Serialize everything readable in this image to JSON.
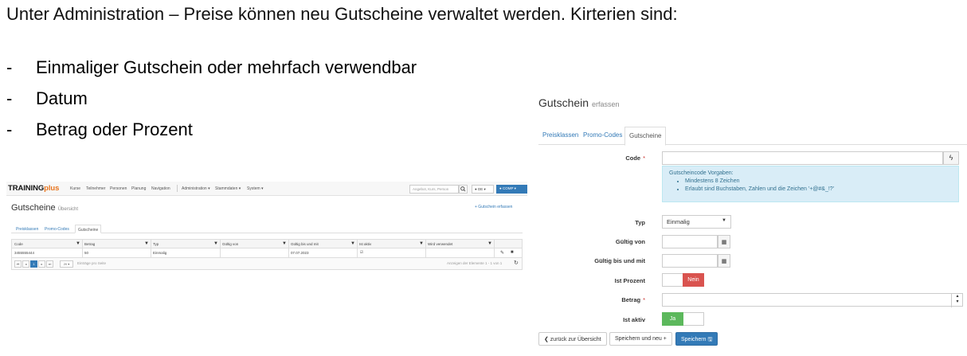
{
  "slide": {
    "intro": "Unter Administration – Preise können neu Gutscheine verwaltet werden. Kirterien sind:",
    "bullets": [
      "Einmaliger Gutschein oder mehrfach verwendbar",
      "Datum",
      "Betrag oder Prozent"
    ]
  },
  "overview": {
    "brand_a": "TRAINING",
    "brand_b": "plus",
    "nav": [
      "Kurse",
      "Teilnehmer",
      "Personen",
      "Planung",
      "Navigation",
      "Administration ▾",
      "Stammdaten ▾",
      "System ▾"
    ],
    "search_placeholder": "Angebot, Kurs, Person",
    "lang": "DE ▾",
    "user": "COMP ▾",
    "title": "Gutscheine",
    "subtitle": "Übersicht",
    "add_link": "+ Gutschein erfassen",
    "tabs": [
      "Preisklassen",
      "Promo-Codes",
      "Gutscheine"
    ],
    "columns": [
      "Code",
      "Betrag",
      "Typ",
      "Gültig von",
      "Gültig bis und mit",
      "Ist aktiv",
      "Wird verwendet"
    ],
    "row": [
      "3455555444",
      "50",
      "Einmalig",
      "",
      "07.07.2023",
      "",
      ""
    ],
    "pager_current": "1",
    "page_size": "20 ▾",
    "page_size_label": "Einträge pro Seite",
    "summary": "Anzeigen der Elemente 1 - 1 von 1"
  },
  "form": {
    "title": "Gutschein",
    "subtitle": "erfassen",
    "tabs": [
      "Preisklassen",
      "Promo-Codes",
      "Gutscheine"
    ],
    "labels": {
      "code": "Code",
      "typ": "Typ",
      "gueltig_von": "Gültig von",
      "gueltig_bis": "Gültig bis und mit",
      "ist_prozent": "Ist Prozent",
      "betrag": "Betrag",
      "ist_aktiv": "Ist aktiv"
    },
    "info_title": "Gutscheincode Vorgaben:",
    "info_items": [
      "Mindestens 8 Zeichen",
      "Erlaubt sind Buchstaben, Zahlen und die Zeichen '+@#&_!?'"
    ],
    "typ_value": "Einmalig",
    "ist_prozent_value": "Nein",
    "ist_aktiv_value": "Ja",
    "buttons": {
      "back": "❮ zurück zur Übersicht",
      "save_new": "Speichern und neu +",
      "save": "Speichern 🖫"
    }
  }
}
